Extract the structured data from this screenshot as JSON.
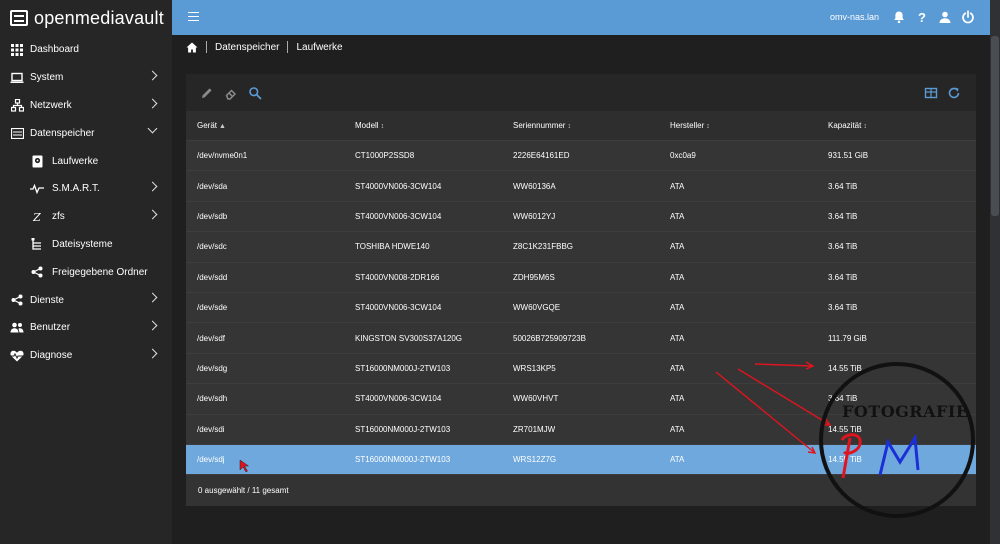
{
  "app": {
    "logo_text": "openmediavault"
  },
  "sidebar": {
    "items": [
      {
        "label": "Dashboard",
        "icon": "grid-icon",
        "level": 0,
        "arrow": ""
      },
      {
        "label": "System",
        "icon": "laptop-icon",
        "level": 0,
        "arrow": "right"
      },
      {
        "label": "Netzwerk",
        "icon": "network-icon",
        "level": 0,
        "arrow": "right"
      },
      {
        "label": "Datenspeicher",
        "icon": "storage-icon",
        "level": 0,
        "arrow": "down"
      },
      {
        "label": "Laufwerke",
        "icon": "disk-icon",
        "level": 1,
        "arrow": ""
      },
      {
        "label": "S.M.A.R.T.",
        "icon": "pulse-icon",
        "level": 1,
        "arrow": "right"
      },
      {
        "label": "zfs",
        "icon": "zfs-icon",
        "level": 1,
        "arrow": "right"
      },
      {
        "label": "Dateisysteme",
        "icon": "tree-icon",
        "level": 1,
        "arrow": ""
      },
      {
        "label": "Freigegebene Ordner",
        "icon": "share-icon",
        "level": 1,
        "arrow": ""
      },
      {
        "label": "Dienste",
        "icon": "share-icon",
        "level": 0,
        "arrow": "right"
      },
      {
        "label": "Benutzer",
        "icon": "users-icon",
        "level": 0,
        "arrow": "right"
      },
      {
        "label": "Diagnose",
        "icon": "heart-pulse-icon",
        "level": 0,
        "arrow": "right"
      }
    ]
  },
  "topbar": {
    "hostname": "omv-nas.lan",
    "icons": [
      "bell-icon",
      "help-icon",
      "user-icon",
      "power-icon"
    ]
  },
  "breadcrumb": {
    "items": [
      "Datenspeicher",
      "Laufwerke"
    ]
  },
  "table": {
    "columns": [
      "Gerät",
      "Modell",
      "Seriennummer",
      "Hersteller",
      "Kapazität"
    ],
    "rows": [
      [
        "/dev/nvme0n1",
        "CT1000P2SSD8",
        "2226E64161ED",
        "0xc0a9",
        "931.51 GiB"
      ],
      [
        "/dev/sda",
        "ST4000VN006-3CW104",
        "WW60136A",
        "ATA",
        "3.64 TiB"
      ],
      [
        "/dev/sdb",
        "ST4000VN006-3CW104",
        "WW6012YJ",
        "ATA",
        "3.64 TiB"
      ],
      [
        "/dev/sdc",
        "TOSHIBA HDWE140",
        "Z8C1K231FBBG",
        "ATA",
        "3.64 TiB"
      ],
      [
        "/dev/sdd",
        "ST4000VN008-2DR166",
        "ZDH95M6S",
        "ATA",
        "3.64 TiB"
      ],
      [
        "/dev/sde",
        "ST4000VN006-3CW104",
        "WW60VGQE",
        "ATA",
        "3.64 TiB"
      ],
      [
        "/dev/sdf",
        "KINGSTON SV300S37A120G",
        "50026B725909723B",
        "ATA",
        "111.79 GiB"
      ],
      [
        "/dev/sdg",
        "ST16000NM000J-2TW103",
        "WRS13KP5",
        "ATA",
        "14.55 TiB"
      ],
      [
        "/dev/sdh",
        "ST4000VN006-3CW104",
        "WW60VHVT",
        "ATA",
        "3.64 TiB"
      ],
      [
        "/dev/sdi",
        "ST16000NM000J-2TW103",
        "ZR701MJW",
        "ATA",
        "14.55 TiB"
      ],
      [
        "/dev/sdj",
        "ST16000NM000J-2TW103",
        "WRS12Z7G",
        "ATA",
        "14.55 TiB"
      ]
    ],
    "selected_row": 10,
    "footer": "0 ausgewählt / 11 gesamt"
  },
  "watermark": {
    "text": "FOTOGRAFIE",
    "monogram": "PM"
  },
  "colors": {
    "accent": "#5b9bd5",
    "selected_row": "#6fa8dc",
    "annotation_red": "#e0141e",
    "monogram_blue": "#1a2fd6"
  }
}
